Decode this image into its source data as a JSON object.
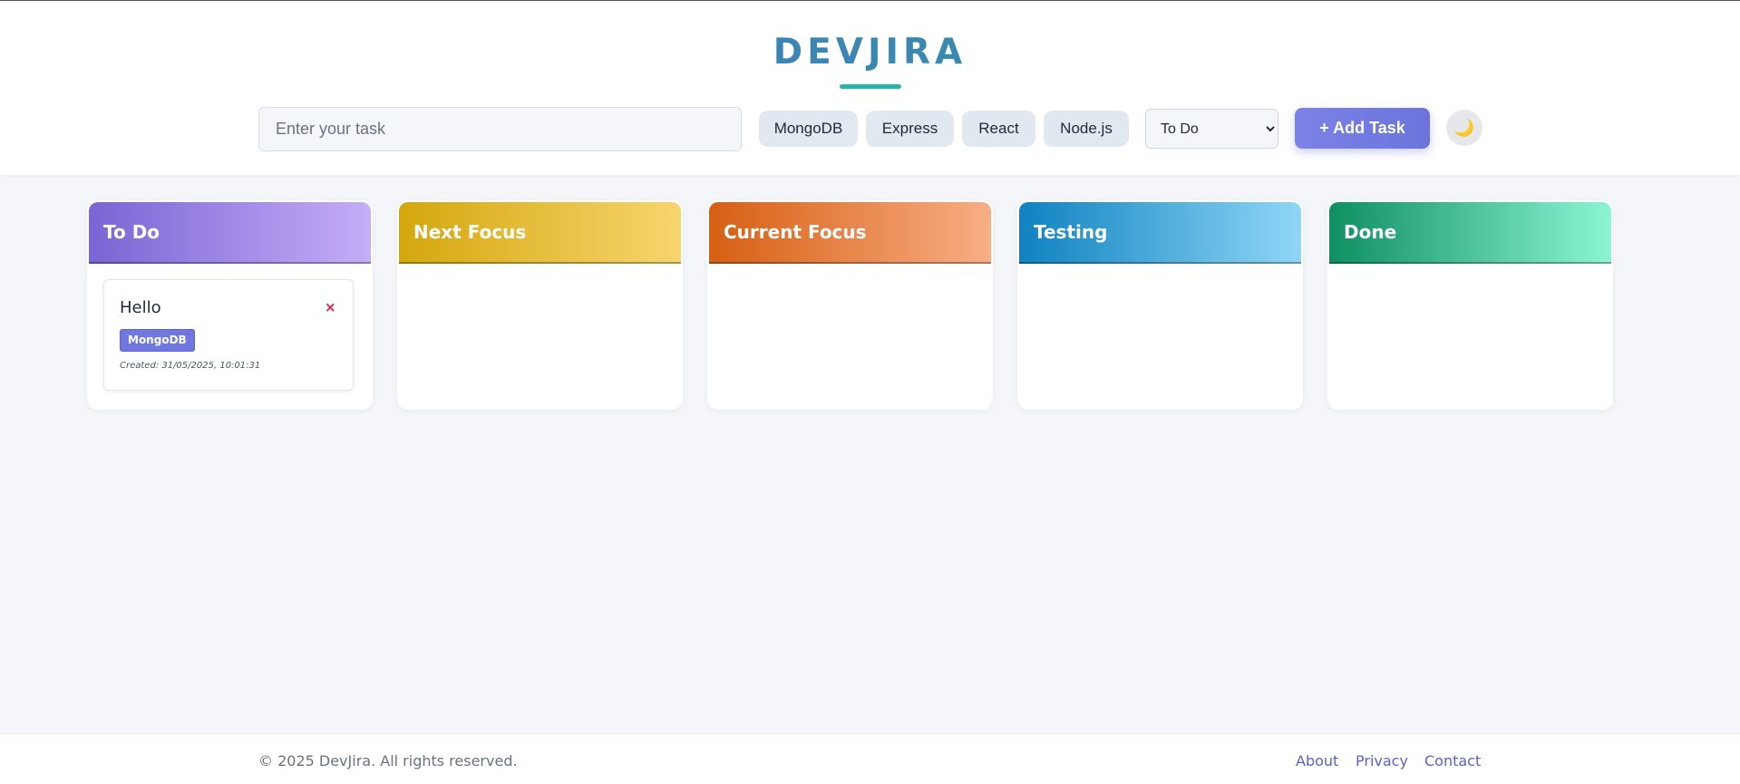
{
  "header": {
    "logo": "DEVJIRA"
  },
  "controls": {
    "task_input_placeholder": "Enter your task",
    "tags": [
      "MongoDB",
      "Express",
      "React",
      "Node.js"
    ],
    "status_selected": "To Do",
    "add_button": "+ Add Task",
    "theme_icon": "moon-icon",
    "theme_glyph": "🌙"
  },
  "columns": [
    {
      "title": "To Do",
      "colors": [
        "#7b64d3",
        "#c4aef8"
      ]
    },
    {
      "title": "Next Focus",
      "colors": [
        "#d4a70e",
        "#f7d56e"
      ]
    },
    {
      "title": "Current Focus",
      "colors": [
        "#d65f12",
        "#f8ae85"
      ]
    },
    {
      "title": "Testing",
      "colors": [
        "#0f82c0",
        "#8fd6f6"
      ]
    },
    {
      "title": "Done",
      "colors": [
        "#0f8f63",
        "#8cf5d3"
      ]
    }
  ],
  "tasks": [
    {
      "title": "Hello",
      "delete_glyph": "×",
      "tag": "MongoDB",
      "created": "Created: 31/05/2025, 10:01:31"
    }
  ],
  "footer": {
    "copyright": "© 2025 DevJira. All rights reserved.",
    "links": [
      "About",
      "Privacy",
      "Contact"
    ]
  },
  "colors": {
    "accent": "#6a74dc",
    "logo_underline": "#2bb3a9",
    "delete": "#e11d48"
  }
}
